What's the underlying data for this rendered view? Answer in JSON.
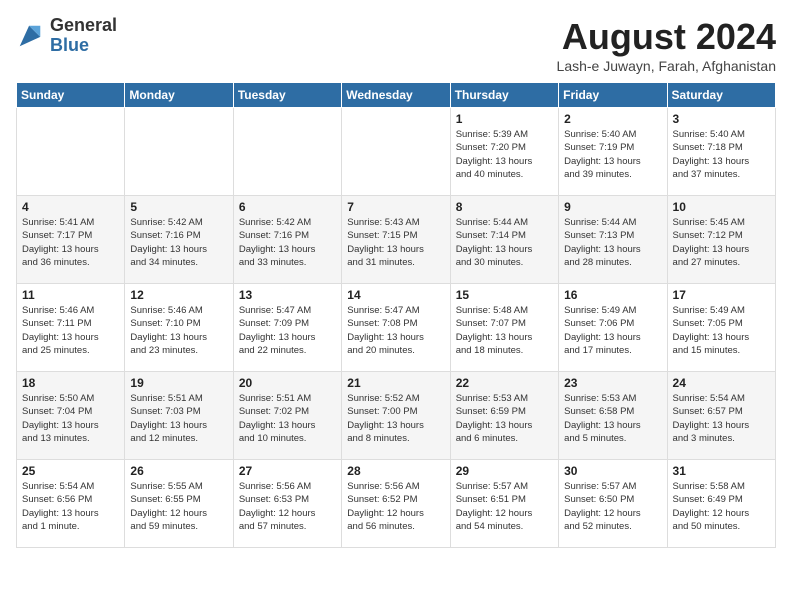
{
  "header": {
    "logo_general": "General",
    "logo_blue": "Blue",
    "title": "August 2024",
    "location": "Lash-e Juwayn, Farah, Afghanistan"
  },
  "weekdays": [
    "Sunday",
    "Monday",
    "Tuesday",
    "Wednesday",
    "Thursday",
    "Friday",
    "Saturday"
  ],
  "weeks": [
    [
      {
        "day": "",
        "info": ""
      },
      {
        "day": "",
        "info": ""
      },
      {
        "day": "",
        "info": ""
      },
      {
        "day": "",
        "info": ""
      },
      {
        "day": "1",
        "info": "Sunrise: 5:39 AM\nSunset: 7:20 PM\nDaylight: 13 hours\nand 40 minutes."
      },
      {
        "day": "2",
        "info": "Sunrise: 5:40 AM\nSunset: 7:19 PM\nDaylight: 13 hours\nand 39 minutes."
      },
      {
        "day": "3",
        "info": "Sunrise: 5:40 AM\nSunset: 7:18 PM\nDaylight: 13 hours\nand 37 minutes."
      }
    ],
    [
      {
        "day": "4",
        "info": "Sunrise: 5:41 AM\nSunset: 7:17 PM\nDaylight: 13 hours\nand 36 minutes."
      },
      {
        "day": "5",
        "info": "Sunrise: 5:42 AM\nSunset: 7:16 PM\nDaylight: 13 hours\nand 34 minutes."
      },
      {
        "day": "6",
        "info": "Sunrise: 5:42 AM\nSunset: 7:16 PM\nDaylight: 13 hours\nand 33 minutes."
      },
      {
        "day": "7",
        "info": "Sunrise: 5:43 AM\nSunset: 7:15 PM\nDaylight: 13 hours\nand 31 minutes."
      },
      {
        "day": "8",
        "info": "Sunrise: 5:44 AM\nSunset: 7:14 PM\nDaylight: 13 hours\nand 30 minutes."
      },
      {
        "day": "9",
        "info": "Sunrise: 5:44 AM\nSunset: 7:13 PM\nDaylight: 13 hours\nand 28 minutes."
      },
      {
        "day": "10",
        "info": "Sunrise: 5:45 AM\nSunset: 7:12 PM\nDaylight: 13 hours\nand 27 minutes."
      }
    ],
    [
      {
        "day": "11",
        "info": "Sunrise: 5:46 AM\nSunset: 7:11 PM\nDaylight: 13 hours\nand 25 minutes."
      },
      {
        "day": "12",
        "info": "Sunrise: 5:46 AM\nSunset: 7:10 PM\nDaylight: 13 hours\nand 23 minutes."
      },
      {
        "day": "13",
        "info": "Sunrise: 5:47 AM\nSunset: 7:09 PM\nDaylight: 13 hours\nand 22 minutes."
      },
      {
        "day": "14",
        "info": "Sunrise: 5:47 AM\nSunset: 7:08 PM\nDaylight: 13 hours\nand 20 minutes."
      },
      {
        "day": "15",
        "info": "Sunrise: 5:48 AM\nSunset: 7:07 PM\nDaylight: 13 hours\nand 18 minutes."
      },
      {
        "day": "16",
        "info": "Sunrise: 5:49 AM\nSunset: 7:06 PM\nDaylight: 13 hours\nand 17 minutes."
      },
      {
        "day": "17",
        "info": "Sunrise: 5:49 AM\nSunset: 7:05 PM\nDaylight: 13 hours\nand 15 minutes."
      }
    ],
    [
      {
        "day": "18",
        "info": "Sunrise: 5:50 AM\nSunset: 7:04 PM\nDaylight: 13 hours\nand 13 minutes."
      },
      {
        "day": "19",
        "info": "Sunrise: 5:51 AM\nSunset: 7:03 PM\nDaylight: 13 hours\nand 12 minutes."
      },
      {
        "day": "20",
        "info": "Sunrise: 5:51 AM\nSunset: 7:02 PM\nDaylight: 13 hours\nand 10 minutes."
      },
      {
        "day": "21",
        "info": "Sunrise: 5:52 AM\nSunset: 7:00 PM\nDaylight: 13 hours\nand 8 minutes."
      },
      {
        "day": "22",
        "info": "Sunrise: 5:53 AM\nSunset: 6:59 PM\nDaylight: 13 hours\nand 6 minutes."
      },
      {
        "day": "23",
        "info": "Sunrise: 5:53 AM\nSunset: 6:58 PM\nDaylight: 13 hours\nand 5 minutes."
      },
      {
        "day": "24",
        "info": "Sunrise: 5:54 AM\nSunset: 6:57 PM\nDaylight: 13 hours\nand 3 minutes."
      }
    ],
    [
      {
        "day": "25",
        "info": "Sunrise: 5:54 AM\nSunset: 6:56 PM\nDaylight: 13 hours\nand 1 minute."
      },
      {
        "day": "26",
        "info": "Sunrise: 5:55 AM\nSunset: 6:55 PM\nDaylight: 12 hours\nand 59 minutes."
      },
      {
        "day": "27",
        "info": "Sunrise: 5:56 AM\nSunset: 6:53 PM\nDaylight: 12 hours\nand 57 minutes."
      },
      {
        "day": "28",
        "info": "Sunrise: 5:56 AM\nSunset: 6:52 PM\nDaylight: 12 hours\nand 56 minutes."
      },
      {
        "day": "29",
        "info": "Sunrise: 5:57 AM\nSunset: 6:51 PM\nDaylight: 12 hours\nand 54 minutes."
      },
      {
        "day": "30",
        "info": "Sunrise: 5:57 AM\nSunset: 6:50 PM\nDaylight: 12 hours\nand 52 minutes."
      },
      {
        "day": "31",
        "info": "Sunrise: 5:58 AM\nSunset: 6:49 PM\nDaylight: 12 hours\nand 50 minutes."
      }
    ]
  ]
}
